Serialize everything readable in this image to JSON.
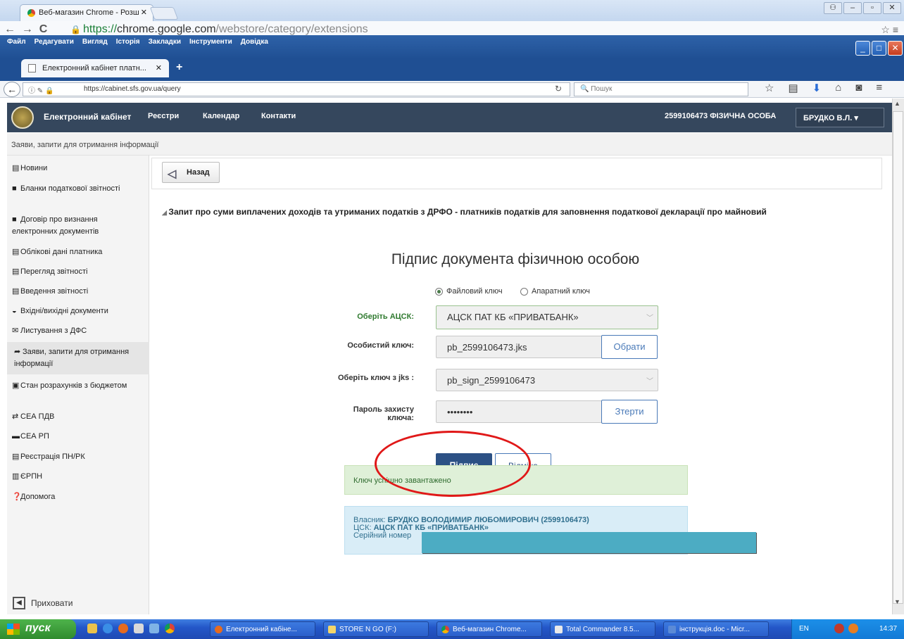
{
  "chrome": {
    "tab_title": "Веб-магазин Chrome - Розш",
    "url_scheme": "https://",
    "url_host": "chrome.google.com",
    "url_path": "/webstore/category/extensions"
  },
  "firefox": {
    "menu": [
      "Файл",
      "Редагувати",
      "Вигляд",
      "Історія",
      "Закладки",
      "Інструменти",
      "Довідка"
    ],
    "tab_title": "Електронний кабінет платн...",
    "url": "https://cabinet.sfs.gov.ua/query",
    "search_placeholder": "Пошук"
  },
  "header": {
    "brand": "Електронний кабінет",
    "nav": [
      "Реєстри",
      "Календар",
      "Контакти"
    ],
    "taxpayer": "2599106473 ФІЗИЧНА ОСОБА",
    "user": "БРУДКО В.Л."
  },
  "breadcrumb": "Заяви, запити для отримання інформації",
  "sidebar": {
    "items": [
      {
        "label": "Новини",
        "icon": "newspaper-icon",
        "glyph": "▤"
      },
      {
        "label": "Бланки податкової звітності",
        "icon": "book-icon",
        "glyph": "■"
      },
      {
        "label": "Договір про визнання електронних документів",
        "icon": "book-icon",
        "glyph": "■"
      },
      {
        "label": "Облікові дані платника",
        "icon": "id-card-icon",
        "glyph": "▤"
      },
      {
        "label": "Перегляд звітності",
        "icon": "document-icon",
        "glyph": "▤"
      },
      {
        "label": "Введення звітності",
        "icon": "form-icon",
        "glyph": "▤"
      },
      {
        "label": "Вхідні/вихідні документи",
        "icon": "inbox-icon",
        "glyph": "◒"
      },
      {
        "label": "Листування з ДФС",
        "icon": "envelope-icon",
        "glyph": "✉"
      },
      {
        "label": "Заяви, запити для отримання інформації",
        "icon": "share-arrow-icon",
        "glyph": "➦"
      },
      {
        "label": "Стан розрахунків з бюджетом",
        "icon": "money-icon",
        "glyph": "▣"
      },
      {
        "label": "СЕА ПДВ",
        "icon": "exchange-icon",
        "glyph": "⇄"
      },
      {
        "label": "СЕА РП",
        "icon": "card-icon",
        "glyph": "▬"
      },
      {
        "label": "Реєстрація ПН/РК",
        "icon": "list-icon",
        "glyph": "▤"
      },
      {
        "label": "ЄРПН",
        "icon": "barcode-icon",
        "glyph": "▥"
      },
      {
        "label": "Допомога",
        "icon": "question-icon",
        "glyph": "❓"
      }
    ],
    "hide_label": "Приховати"
  },
  "main": {
    "back_label": "Назад",
    "request_title": "Запит про суми виплачених доходів та утриманих податків з ДРФО - платників податків для заповнення податкової декларації про майновий",
    "sign_title": "Підпис документа фізичною особою",
    "key_types": [
      "Файловий ключ",
      "Апаратний ключ"
    ],
    "selected_key_type": "Файловий ключ",
    "acsk_label": "Оберіть АЦСК:",
    "acsk_value": "АЦСК ПАТ КБ «ПРИВАТБАНК»",
    "private_key_label": "Особистий ключ:",
    "private_key_value": "pb_2599106473.jks",
    "browse_label": "Обрати",
    "jks_key_label": "Оберіть ключ з jks :",
    "jks_key_value": "pb_sign_2599106473",
    "password_label": "Пароль захисту ключа:",
    "password_value": "••••••••",
    "clear_label": "Зтерти",
    "sign_label": "Підпис",
    "cancel_label": "Відміна",
    "success_message": "Ключ успішно завантажено",
    "owner_label": "Власник: ",
    "owner_value": "БРУДКО ВОЛОДИМИР ЛЮБОМИРОВИЧ (2599106473)",
    "csk_label": "ЦСК: ",
    "csk_value": "АЦСК ПАТ КБ «ПРИВАТБАНК»",
    "serial_label": "Серійний номер"
  },
  "taskbar": {
    "start": "пуск",
    "tasks": [
      "Електронний кабіне...",
      "STORE N GO (F:)",
      "Веб-магазин Chrome...",
      "Total Commander 8.5...",
      "інструкція.doc - Micr..."
    ],
    "lang": "EN",
    "time": "14:37"
  },
  "colors": {
    "header_bg": "#35475d",
    "primary_button": "#2c5185",
    "success_bg": "#dff0d8",
    "info_bg": "#d9edf7",
    "annotation": "#e01818",
    "redaction": "#4cacc3"
  }
}
